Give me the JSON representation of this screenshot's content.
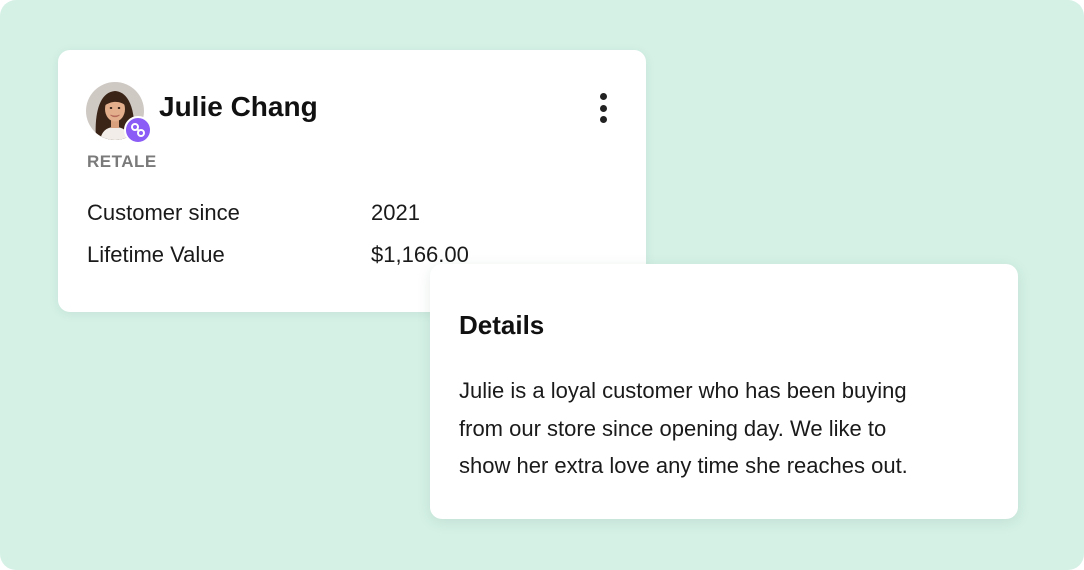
{
  "customer": {
    "name": "Julie Chang",
    "company": "RETALE",
    "fields": [
      {
        "label": "Customer since",
        "value": "2021"
      },
      {
        "label": "Lifetime Value",
        "value": "$1,166.00"
      }
    ],
    "avatar_icon": "person-photo",
    "badge_icon": "link-icon",
    "menu_icon": "vertical-ellipsis-icon"
  },
  "details": {
    "title": "Details",
    "lines": [
      "Julie is a loyal customer who has been buying",
      "from our store since opening day. We like to",
      "show her extra love any time she reaches out."
    ]
  },
  "colors": {
    "background": "#d5f1e6",
    "card": "#ffffff",
    "badge": "#8b5cf6",
    "muted_text": "#7a7a7a"
  }
}
